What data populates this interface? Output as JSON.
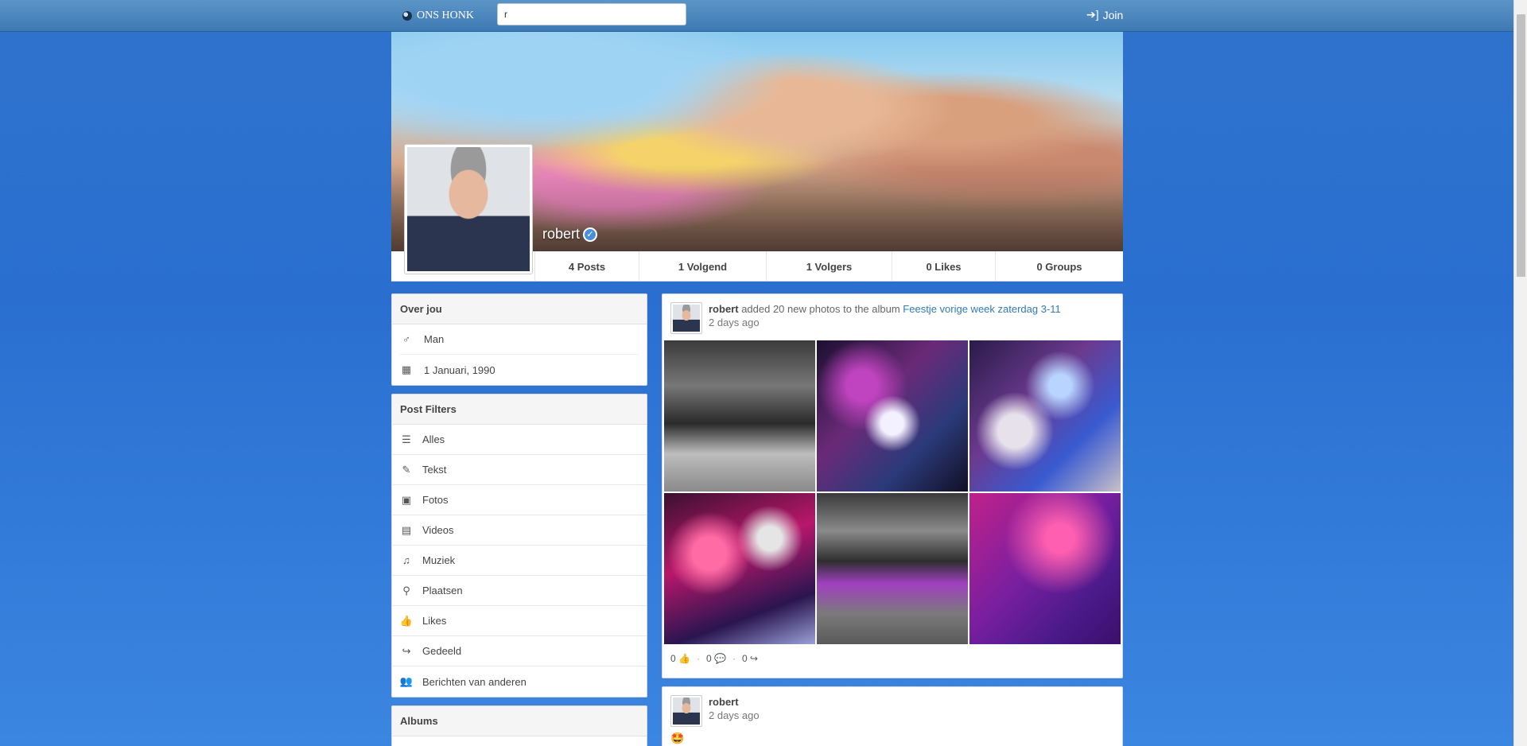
{
  "navbar": {
    "brand": "ONS HONK",
    "search_value": "r",
    "join_label": "Join"
  },
  "profile": {
    "name": "robert",
    "stats": {
      "posts": "4 Posts",
      "following": "1 Volgend",
      "followers": "1 Volgers",
      "likes": "0 Likes",
      "groups": "0 Groups"
    }
  },
  "about": {
    "title": "Over jou",
    "gender": "Man",
    "birthday": "1 Januari, 1990"
  },
  "filters": {
    "title": "Post Filters",
    "items": [
      {
        "label": "Alles",
        "icon": "newspaper-icon"
      },
      {
        "label": "Tekst",
        "icon": "pencil-icon"
      },
      {
        "label": "Fotos",
        "icon": "camera-icon"
      },
      {
        "label": "Videos",
        "icon": "film-icon"
      },
      {
        "label": "Muziek",
        "icon": "music-icon"
      },
      {
        "label": "Plaatsen",
        "icon": "map-marker-icon"
      },
      {
        "label": "Likes",
        "icon": "thumbs-up-icon"
      },
      {
        "label": "Gedeeld",
        "icon": "share-icon"
      },
      {
        "label": "Berichten van anderen",
        "icon": "users-icon"
      }
    ]
  },
  "albums": {
    "title": "Albums"
  },
  "posts": [
    {
      "author": "robert",
      "action": "added 20 new photos to the album",
      "album": "Feestje vorige week zaterdag 3-11",
      "time": "2 days ago",
      "likes": "0",
      "comments": "0",
      "shares": "0"
    },
    {
      "author": "robert",
      "time": "2 days ago",
      "content": "🤩"
    }
  ],
  "colors": {
    "background": "#2f73cc",
    "navbar": "#4a86bf",
    "link": "#337ab7"
  }
}
